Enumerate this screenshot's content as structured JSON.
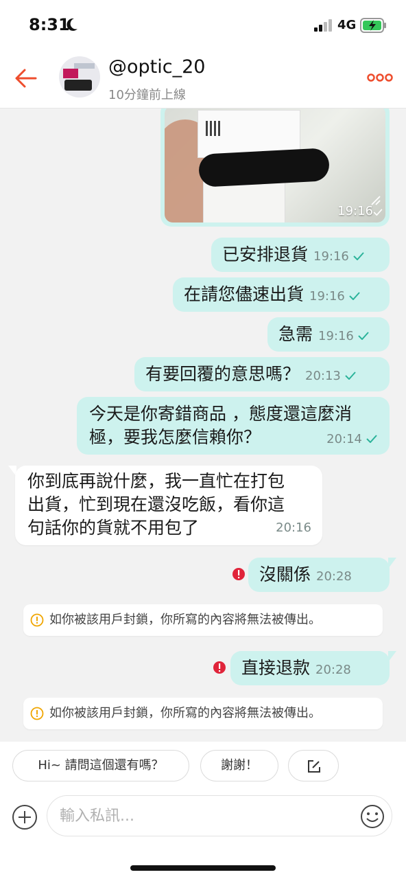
{
  "status_bar": {
    "time": "8:31",
    "network": "4G",
    "icons": [
      "moon-icon",
      "signal-icon",
      "battery-charging-icon"
    ]
  },
  "header": {
    "username": "@optic_20",
    "status": "10分鐘前上線",
    "icons": [
      "back-arrow-icon",
      "more-icon"
    ],
    "accent_color": "#ee4d2d"
  },
  "messages": [
    {
      "type": "image",
      "dir": "out",
      "time": "19:16",
      "read": true
    },
    {
      "dir": "out",
      "text": "已安排退貨",
      "time": "19:16",
      "read": true
    },
    {
      "dir": "out",
      "text": "在請您儘速出貨",
      "time": "19:16",
      "read": true
    },
    {
      "dir": "out",
      "text": "急需",
      "time": "19:16",
      "read": true
    },
    {
      "dir": "out",
      "text": "有要回覆的意思嗎？",
      "time": "20:13",
      "read": true
    },
    {
      "dir": "out",
      "text_line1": "今天是你寄錯商品 ，態度還這麼消",
      "text_line2": "極，要我怎麼信賴你？",
      "time": "20:14",
      "read": true
    },
    {
      "dir": "in",
      "text_line1": "你到底再說什麼，我一直忙在打包",
      "text_line2": "出貨，忙到現在還沒吃飯，看你這",
      "text_line3": "句話你的貨就不用包了",
      "time": "20:16"
    },
    {
      "dir": "out",
      "text": "沒關係",
      "time": "20:28",
      "failed": true
    },
    {
      "dir": "out",
      "text": "直接退款",
      "time": "20:28",
      "failed": true
    }
  ],
  "notice": {
    "text": "如你被該用戶封鎖，你所寫的內容將無法被傳出。"
  },
  "quick_replies": [
    "Hi~ 請問這個還有嗎？",
    "謝謝！"
  ],
  "input": {
    "placeholder": "輸入私訊..."
  },
  "colors": {
    "outgoing_bubble": "#cdf2ee",
    "incoming_bubble": "#ffffff",
    "error": "#e0243a",
    "warning": "#f0a500",
    "read_check": "#2bb39a"
  }
}
